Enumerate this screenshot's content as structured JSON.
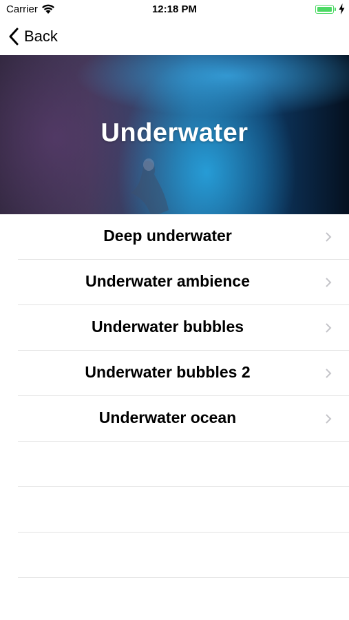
{
  "status_bar": {
    "carrier": "Carrier",
    "time": "12:18 PM",
    "battery_level": 1.0,
    "accent_battery": "#4cd964"
  },
  "nav": {
    "back_label": "Back"
  },
  "header": {
    "title": "Underwater"
  },
  "sounds": [
    {
      "label": "Deep underwater"
    },
    {
      "label": "Underwater ambience"
    },
    {
      "label": "Underwater bubbles"
    },
    {
      "label": "Underwater bubbles 2"
    },
    {
      "label": "Underwater ocean"
    }
  ],
  "icons": {
    "back": "chevron-left-icon",
    "row": "chevron-right-icon",
    "wifi": "wifi-icon",
    "battery": "battery-icon",
    "charging": "bolt-icon"
  }
}
